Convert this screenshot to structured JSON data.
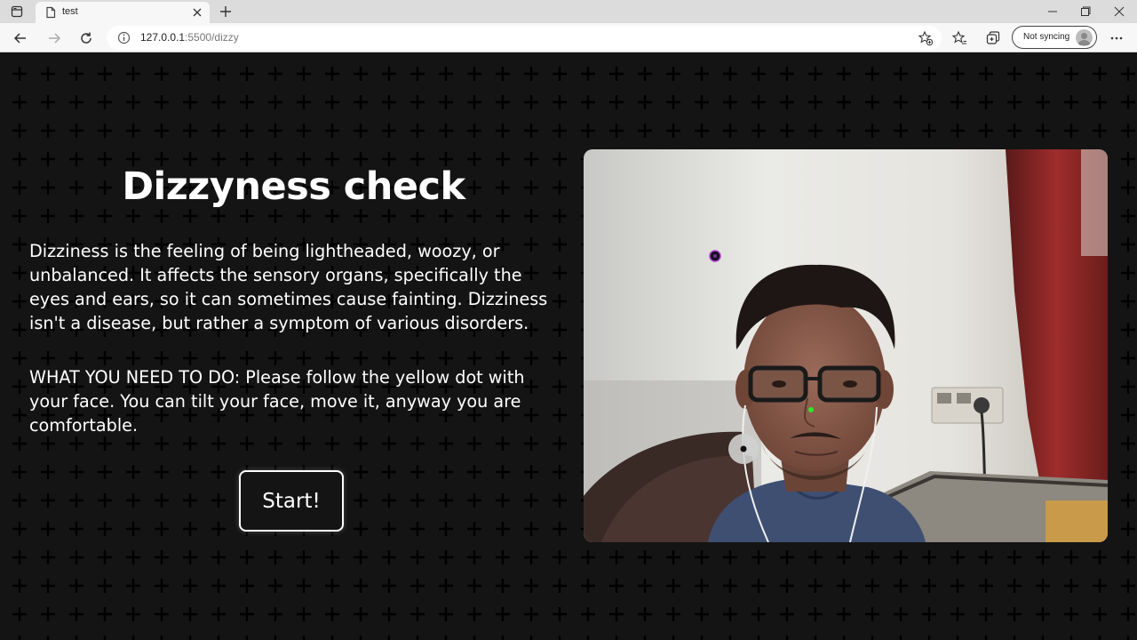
{
  "browser": {
    "tab_title": "test",
    "url_host": "127.0.0.1",
    "url_rest": ":5500/dizzy",
    "sync_label": "Not syncing"
  },
  "page": {
    "title": "Dizzyness check",
    "description": "Dizziness is the feeling of being lightheaded, woozy, or unbalanced. It affects the sensory organs, specifically the eyes and ears, so it can sometimes cause fainting. Dizziness isn't a disease, but rather a symptom of various disorders.",
    "instructions": "WHAT YOU NEED TO DO: Please follow the yellow dot with your face. You can tilt your face, move it, anyway you are comfortable.",
    "start_label": "Start!"
  },
  "colors": {
    "background": "#141414",
    "text": "#ffffff",
    "pattern": "#000000",
    "tracking_dot": "#1a0f24",
    "tracking_dot_ring": "#b040d0",
    "nose_dot": "#2ee82e",
    "target_dot": "#d0d0d0"
  },
  "icons": {
    "tab_actions": "tab-actions-icon",
    "page": "page-icon",
    "close": "close-icon",
    "new_tab": "plus-icon",
    "minimize": "minimize-icon",
    "maximize": "maximize-icon",
    "window_close": "window-close-icon",
    "back": "back-arrow-icon",
    "forward": "forward-arrow-icon",
    "refresh": "refresh-icon",
    "info": "info-icon",
    "add_favorite": "star-plus-icon",
    "favorites": "favorites-icon",
    "collections": "collections-icon",
    "profile": "avatar-icon",
    "more": "more-icon"
  }
}
